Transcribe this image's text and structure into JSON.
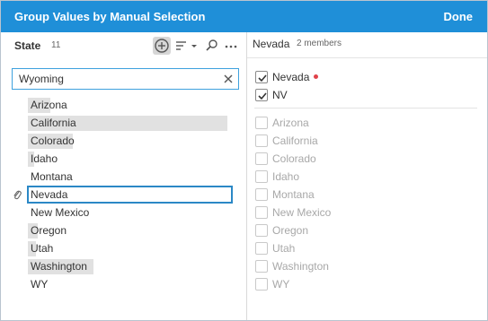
{
  "dialog": {
    "title": "Group Values by Manual Selection",
    "done_label": "Done",
    "accent_color": "#1f8fd8"
  },
  "left_panel": {
    "field_name": "State",
    "field_count": "11",
    "toolbar": {
      "add_icon": "add-circle-icon",
      "sort_icon": "sort-dropdown-icon",
      "search_icon": "search-icon",
      "more_icon": "more-icon"
    },
    "search": {
      "value": "Wyoming"
    },
    "values": [
      {
        "label": "Arizona",
        "bar": 0.11
      },
      {
        "label": "California",
        "bar": 0.98
      },
      {
        "label": "Colorado",
        "bar": 0.22
      },
      {
        "label": "Idaho",
        "bar": 0.03
      },
      {
        "label": "Montana",
        "bar": 0.0
      },
      {
        "label": "Nevada",
        "bar": 0.0,
        "selected": true,
        "grouped": true
      },
      {
        "label": "New Mexico",
        "bar": 0.0
      },
      {
        "label": "Oregon",
        "bar": 0.05
      },
      {
        "label": "Utah",
        "bar": 0.04
      },
      {
        "label": "Washington",
        "bar": 0.32
      },
      {
        "label": "WY",
        "bar": 0.0
      }
    ]
  },
  "right_panel": {
    "group_name": "Nevada",
    "member_count": "2 members",
    "members": [
      {
        "label": "Nevada",
        "checked": true,
        "has_dot": true
      },
      {
        "label": "NV",
        "checked": true
      }
    ],
    "others": [
      {
        "label": "Arizona",
        "checked": false
      },
      {
        "label": "California",
        "checked": false
      },
      {
        "label": "Colorado",
        "checked": false
      },
      {
        "label": "Idaho",
        "checked": false
      },
      {
        "label": "Montana",
        "checked": false
      },
      {
        "label": "New Mexico",
        "checked": false
      },
      {
        "label": "Oregon",
        "checked": false
      },
      {
        "label": "Utah",
        "checked": false
      },
      {
        "label": "Washington",
        "checked": false
      },
      {
        "label": "WY",
        "checked": false
      }
    ]
  }
}
